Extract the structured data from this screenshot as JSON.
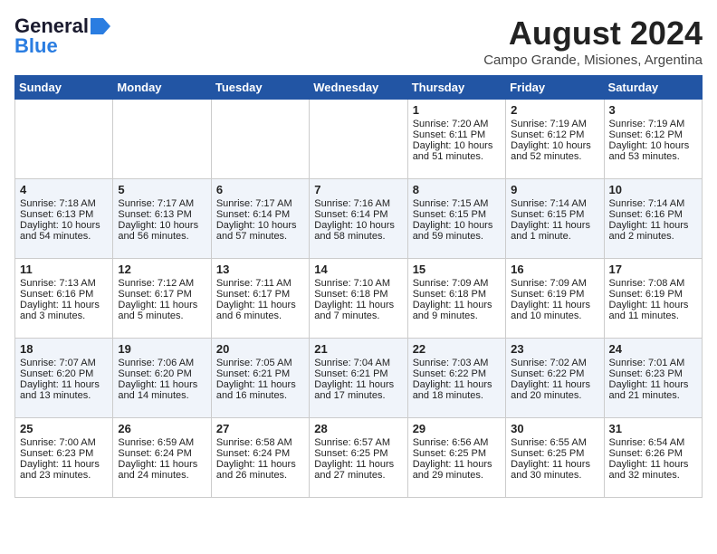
{
  "header": {
    "logo_line1": "General",
    "logo_line2": "Blue",
    "month_year": "August 2024",
    "location": "Campo Grande, Misiones, Argentina"
  },
  "weekdays": [
    "Sunday",
    "Monday",
    "Tuesday",
    "Wednesday",
    "Thursday",
    "Friday",
    "Saturday"
  ],
  "weeks": [
    [
      {
        "day": "",
        "sunrise": "",
        "sunset": "",
        "daylight": ""
      },
      {
        "day": "",
        "sunrise": "",
        "sunset": "",
        "daylight": ""
      },
      {
        "day": "",
        "sunrise": "",
        "sunset": "",
        "daylight": ""
      },
      {
        "day": "",
        "sunrise": "",
        "sunset": "",
        "daylight": ""
      },
      {
        "day": "1",
        "sunrise": "Sunrise: 7:20 AM",
        "sunset": "Sunset: 6:11 PM",
        "daylight": "Daylight: 10 hours and 51 minutes."
      },
      {
        "day": "2",
        "sunrise": "Sunrise: 7:19 AM",
        "sunset": "Sunset: 6:12 PM",
        "daylight": "Daylight: 10 hours and 52 minutes."
      },
      {
        "day": "3",
        "sunrise": "Sunrise: 7:19 AM",
        "sunset": "Sunset: 6:12 PM",
        "daylight": "Daylight: 10 hours and 53 minutes."
      }
    ],
    [
      {
        "day": "4",
        "sunrise": "Sunrise: 7:18 AM",
        "sunset": "Sunset: 6:13 PM",
        "daylight": "Daylight: 10 hours and 54 minutes."
      },
      {
        "day": "5",
        "sunrise": "Sunrise: 7:17 AM",
        "sunset": "Sunset: 6:13 PM",
        "daylight": "Daylight: 10 hours and 56 minutes."
      },
      {
        "day": "6",
        "sunrise": "Sunrise: 7:17 AM",
        "sunset": "Sunset: 6:14 PM",
        "daylight": "Daylight: 10 hours and 57 minutes."
      },
      {
        "day": "7",
        "sunrise": "Sunrise: 7:16 AM",
        "sunset": "Sunset: 6:14 PM",
        "daylight": "Daylight: 10 hours and 58 minutes."
      },
      {
        "day": "8",
        "sunrise": "Sunrise: 7:15 AM",
        "sunset": "Sunset: 6:15 PM",
        "daylight": "Daylight: 10 hours and 59 minutes."
      },
      {
        "day": "9",
        "sunrise": "Sunrise: 7:14 AM",
        "sunset": "Sunset: 6:15 PM",
        "daylight": "Daylight: 11 hours and 1 minute."
      },
      {
        "day": "10",
        "sunrise": "Sunrise: 7:14 AM",
        "sunset": "Sunset: 6:16 PM",
        "daylight": "Daylight: 11 hours and 2 minutes."
      }
    ],
    [
      {
        "day": "11",
        "sunrise": "Sunrise: 7:13 AM",
        "sunset": "Sunset: 6:16 PM",
        "daylight": "Daylight: 11 hours and 3 minutes."
      },
      {
        "day": "12",
        "sunrise": "Sunrise: 7:12 AM",
        "sunset": "Sunset: 6:17 PM",
        "daylight": "Daylight: 11 hours and 5 minutes."
      },
      {
        "day": "13",
        "sunrise": "Sunrise: 7:11 AM",
        "sunset": "Sunset: 6:17 PM",
        "daylight": "Daylight: 11 hours and 6 minutes."
      },
      {
        "day": "14",
        "sunrise": "Sunrise: 7:10 AM",
        "sunset": "Sunset: 6:18 PM",
        "daylight": "Daylight: 11 hours and 7 minutes."
      },
      {
        "day": "15",
        "sunrise": "Sunrise: 7:09 AM",
        "sunset": "Sunset: 6:18 PM",
        "daylight": "Daylight: 11 hours and 9 minutes."
      },
      {
        "day": "16",
        "sunrise": "Sunrise: 7:09 AM",
        "sunset": "Sunset: 6:19 PM",
        "daylight": "Daylight: 11 hours and 10 minutes."
      },
      {
        "day": "17",
        "sunrise": "Sunrise: 7:08 AM",
        "sunset": "Sunset: 6:19 PM",
        "daylight": "Daylight: 11 hours and 11 minutes."
      }
    ],
    [
      {
        "day": "18",
        "sunrise": "Sunrise: 7:07 AM",
        "sunset": "Sunset: 6:20 PM",
        "daylight": "Daylight: 11 hours and 13 minutes."
      },
      {
        "day": "19",
        "sunrise": "Sunrise: 7:06 AM",
        "sunset": "Sunset: 6:20 PM",
        "daylight": "Daylight: 11 hours and 14 minutes."
      },
      {
        "day": "20",
        "sunrise": "Sunrise: 7:05 AM",
        "sunset": "Sunset: 6:21 PM",
        "daylight": "Daylight: 11 hours and 16 minutes."
      },
      {
        "day": "21",
        "sunrise": "Sunrise: 7:04 AM",
        "sunset": "Sunset: 6:21 PM",
        "daylight": "Daylight: 11 hours and 17 minutes."
      },
      {
        "day": "22",
        "sunrise": "Sunrise: 7:03 AM",
        "sunset": "Sunset: 6:22 PM",
        "daylight": "Daylight: 11 hours and 18 minutes."
      },
      {
        "day": "23",
        "sunrise": "Sunrise: 7:02 AM",
        "sunset": "Sunset: 6:22 PM",
        "daylight": "Daylight: 11 hours and 20 minutes."
      },
      {
        "day": "24",
        "sunrise": "Sunrise: 7:01 AM",
        "sunset": "Sunset: 6:23 PM",
        "daylight": "Daylight: 11 hours and 21 minutes."
      }
    ],
    [
      {
        "day": "25",
        "sunrise": "Sunrise: 7:00 AM",
        "sunset": "Sunset: 6:23 PM",
        "daylight": "Daylight: 11 hours and 23 minutes."
      },
      {
        "day": "26",
        "sunrise": "Sunrise: 6:59 AM",
        "sunset": "Sunset: 6:24 PM",
        "daylight": "Daylight: 11 hours and 24 minutes."
      },
      {
        "day": "27",
        "sunrise": "Sunrise: 6:58 AM",
        "sunset": "Sunset: 6:24 PM",
        "daylight": "Daylight: 11 hours and 26 minutes."
      },
      {
        "day": "28",
        "sunrise": "Sunrise: 6:57 AM",
        "sunset": "Sunset: 6:25 PM",
        "daylight": "Daylight: 11 hours and 27 minutes."
      },
      {
        "day": "29",
        "sunrise": "Sunrise: 6:56 AM",
        "sunset": "Sunset: 6:25 PM",
        "daylight": "Daylight: 11 hours and 29 minutes."
      },
      {
        "day": "30",
        "sunrise": "Sunrise: 6:55 AM",
        "sunset": "Sunset: 6:25 PM",
        "daylight": "Daylight: 11 hours and 30 minutes."
      },
      {
        "day": "31",
        "sunrise": "Sunrise: 6:54 AM",
        "sunset": "Sunset: 6:26 PM",
        "daylight": "Daylight: 11 hours and 32 minutes."
      }
    ]
  ]
}
